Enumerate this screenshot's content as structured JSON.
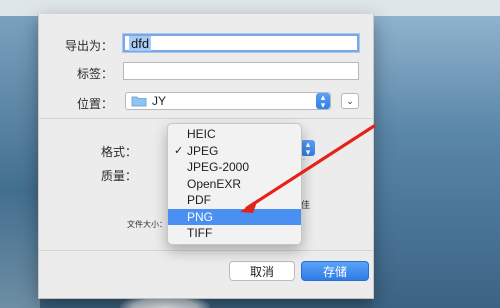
{
  "dialog": {
    "export_as_label": "导出为：",
    "export_as_value": "dfd",
    "tags_label": "标签：",
    "tags_value": "",
    "location_label": "位置：",
    "location_value": "JY",
    "format_label": "格式：",
    "quality_label": "质量：",
    "file_size_label": "文件大小：",
    "partial_text": "佳",
    "cancel_label": "取消",
    "save_label": "存储"
  },
  "format_menu": {
    "items": [
      {
        "label": "HEIC",
        "checked": false,
        "highlighted": false
      },
      {
        "label": "JPEG",
        "checked": true,
        "highlighted": false
      },
      {
        "label": "JPEG-2000",
        "checked": false,
        "highlighted": false
      },
      {
        "label": "OpenEXR",
        "checked": false,
        "highlighted": false
      },
      {
        "label": "PDF",
        "checked": false,
        "highlighted": false
      },
      {
        "label": "PNG",
        "checked": false,
        "highlighted": true
      },
      {
        "label": "TIFF",
        "checked": false,
        "highlighted": false
      }
    ],
    "check_glyph": "✓"
  },
  "colors": {
    "accent": "#4a8ff2",
    "annotation_arrow": "#e62117"
  },
  "icons": {
    "folder": "folder-icon",
    "stepper": "updown-chevron-icon",
    "expand": "chevron-down-icon"
  }
}
